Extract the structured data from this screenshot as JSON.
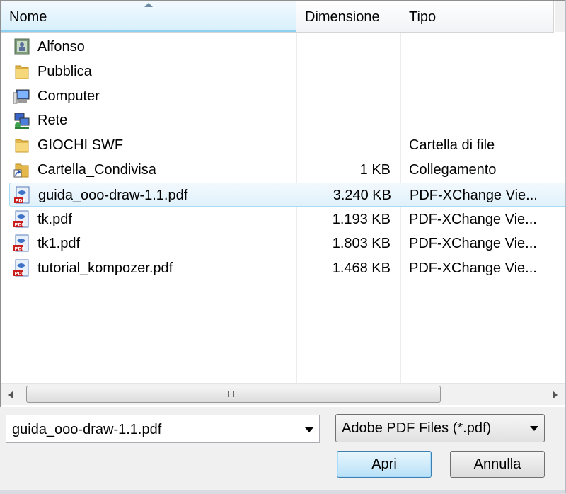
{
  "columns": {
    "name": "Nome",
    "size": "Dimensione",
    "type": "Tipo"
  },
  "files": [
    {
      "name": "Alfonso",
      "size": "",
      "type": "",
      "icon": "user-folder-icon"
    },
    {
      "name": "Pubblica",
      "size": "",
      "type": "",
      "icon": "folder-icon"
    },
    {
      "name": "Computer",
      "size": "",
      "type": "",
      "icon": "computer-icon"
    },
    {
      "name": "Rete",
      "size": "",
      "type": "",
      "icon": "network-icon"
    },
    {
      "name": "GIOCHI SWF",
      "size": "",
      "type": "Cartella di file",
      "icon": "folder-icon"
    },
    {
      "name": "Cartella_Condivisa",
      "size": "1 KB",
      "type": "Collegamento",
      "icon": "shortcut-icon"
    },
    {
      "name": "guida_ooo-draw-1.1.pdf",
      "size": "3.240 KB",
      "type": "PDF-XChange Vie...",
      "icon": "pdf-icon",
      "selected": true
    },
    {
      "name": "tk.pdf",
      "size": "1.193 KB",
      "type": "PDF-XChange Vie...",
      "icon": "pdf-icon"
    },
    {
      "name": "tk1.pdf",
      "size": "1.803 KB",
      "type": "PDF-XChange Vie...",
      "icon": "pdf-icon"
    },
    {
      "name": "tutorial_kompozer.pdf",
      "size": "1.468 KB",
      "type": "PDF-XChange Vie...",
      "icon": "pdf-icon"
    }
  ],
  "filename_field": {
    "value": "guida_ooo-draw-1.1.pdf"
  },
  "filter": {
    "value": "Adobe PDF Files (*.pdf)"
  },
  "buttons": {
    "open": "Apri",
    "cancel": "Annulla"
  },
  "colors": {
    "selection": "#e0f1fb",
    "selection_border": "#a9dbf6",
    "header_active": "#d8f0fc"
  }
}
